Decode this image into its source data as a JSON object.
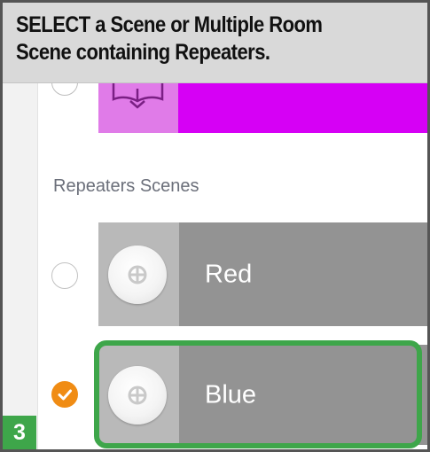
{
  "header": {
    "line1": "SELECT a Scene or Multiple Room",
    "line2": "Scene containing Repeaters."
  },
  "section_title": "Repeaters Scenes",
  "scenes": [
    {
      "label": "Red",
      "selected": false,
      "icon": "keypad-button-icon"
    },
    {
      "label": "Blue",
      "selected": true,
      "icon": "keypad-button-icon"
    }
  ],
  "step_number": "3",
  "colors": {
    "header_bg": "#d9d9d9",
    "purple_bar": "#d600f5",
    "purple_thumb": "#e07be8",
    "scene_bar": "#939393",
    "scene_thumb": "#b9b9b9",
    "selected_radio": "#f08c14",
    "highlight": "#3ea64a"
  }
}
